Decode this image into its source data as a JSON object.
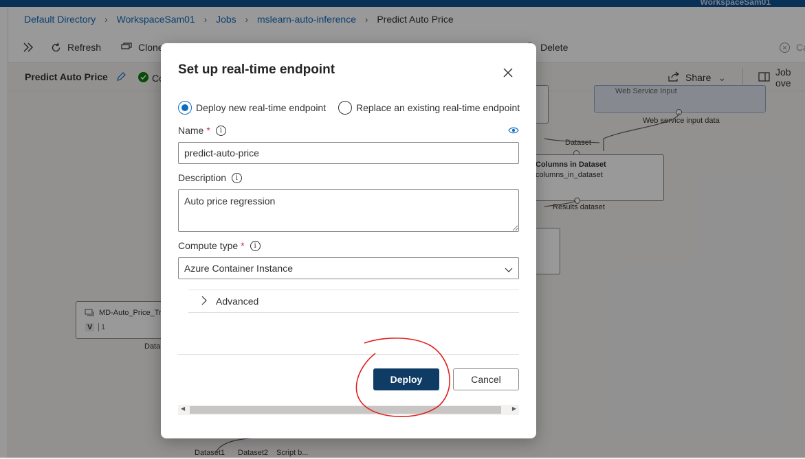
{
  "account": "WorkspaceSam01",
  "breadcrumb": {
    "items": [
      "Default Directory",
      "WorkspaceSam01",
      "Jobs",
      "mslearn-auto-inference"
    ],
    "current": "Predict Auto Price"
  },
  "toolbar": {
    "refresh": "Refresh",
    "clone": "Clone",
    "delete": "Delete",
    "cancel": "Ca"
  },
  "subbar": {
    "title": "Predict Auto Price",
    "status": "Co",
    "share": "Share",
    "job_overview": "Job ove"
  },
  "canvas": {
    "web_service_input_title": "Web Service Input",
    "web_service_input_data": "Web service input data",
    "dataset_port": "Dataset",
    "columns_title": "Columns in Dataset",
    "columns_sub": "columns_in_dataset",
    "results_dataset": "Results dataset",
    "md_node_title": "MD-Auto_Price_Tr",
    "md_node_version_label": "V",
    "md_node_version": "1",
    "md_port": "Data",
    "bottom_ports": [
      "Dataset1",
      "Dataset2",
      "Script b..."
    ]
  },
  "dialog": {
    "title": "Set up real-time endpoint",
    "radio_new": "Deploy new real-time endpoint",
    "radio_replace": "Replace an existing real-time endpoint",
    "name_label": "Name",
    "name_value": "predict-auto-price",
    "description_label": "Description",
    "description_value": "Auto price regression",
    "compute_label": "Compute type",
    "compute_value": "Azure Container Instance",
    "advanced": "Advanced",
    "deploy": "Deploy",
    "cancel": "Cancel"
  },
  "colors": {
    "accent": "#0f6cbd",
    "primary_button": "#0f3c65",
    "annotation": "#e0201c",
    "success": "#107c10"
  }
}
